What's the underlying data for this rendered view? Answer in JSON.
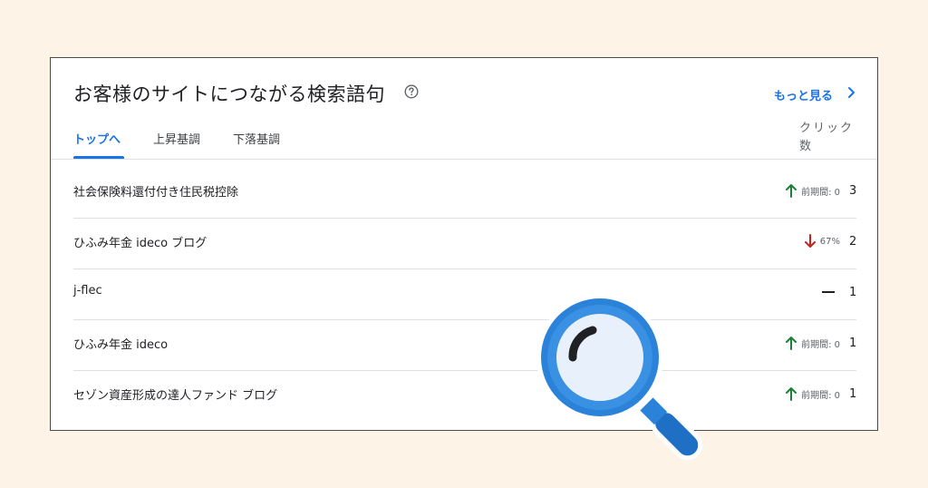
{
  "card": {
    "title": "お客様のサイトにつながる検索語句",
    "more_link": "もっと見る",
    "clicks_header": "クリック数"
  },
  "tabs": [
    {
      "label": "トップへ",
      "active": true
    },
    {
      "label": "上昇基調",
      "active": false
    },
    {
      "label": "下落基調",
      "active": false
    }
  ],
  "rows": [
    {
      "query": "社会保険料還付付き住民税控除",
      "trend": "up",
      "trend_text": "前期間: 0",
      "clicks": "3"
    },
    {
      "query": "ひふみ年金 ideco ブログ",
      "trend": "down",
      "trend_text": "67%",
      "clicks": "2"
    },
    {
      "query": "j-flec",
      "trend": "flat",
      "trend_text": "",
      "clicks": "1"
    },
    {
      "query": "ひふみ年金 ideco",
      "trend": "up",
      "trend_text": "前期間: 0",
      "clicks": "1"
    },
    {
      "query": "セゾン資産形成の達人ファンド ブログ",
      "trend": "up",
      "trend_text": "前期間: 0",
      "clicks": "1"
    }
  ],
  "colors": {
    "accent": "#1a73e8",
    "trend_up": "#188038",
    "trend_down": "#c5221f",
    "background": "#fdf3e7",
    "magnifier_blue": "#2b82d9"
  },
  "icons": {
    "help": "help-circle-icon",
    "more": "chevron-right-icon",
    "up": "arrow-up-icon",
    "down": "arrow-down-icon",
    "magnifier": "magnifying-glass-icon"
  }
}
